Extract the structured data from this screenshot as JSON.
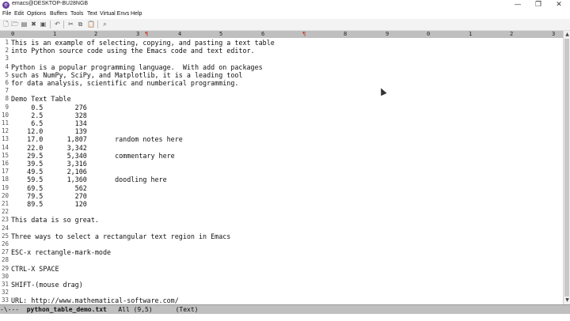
{
  "window": {
    "title": "emacs@DESKTOP-BU28NGB",
    "minimize_glyph": "—",
    "restore_glyph": "❐",
    "close_glyph": "✕"
  },
  "menu": [
    "File",
    "Edit",
    "Options",
    "Buffers",
    "Tools",
    "Text",
    "Virtual Envs",
    "Help"
  ],
  "toolbar": {
    "icons": [
      "new-file-icon",
      "open-folder-icon",
      "dired-icon",
      "close-buffer-icon",
      "save-icon",
      "undo-icon",
      "cut-icon",
      "copy-icon",
      "paste-icon",
      "search-icon"
    ]
  },
  "ruler": {
    "numbers": [
      "0",
      "1",
      "2",
      "3",
      "4",
      "5",
      "6",
      "7",
      "8",
      "9",
      "0",
      "1",
      "2",
      "3"
    ],
    "marker": "¶"
  },
  "buffer": {
    "lines": [
      "This is an example of selecting, copying, and pasting a text table",
      "into Python source code using the Emacs code and text editor.",
      "",
      "Python is a popular programming language.  With add on packages",
      "such as NumPy, SciPy, and Matplotlib, it is a leading tool",
      "for data analysis, scientific and numberical programming.",
      "",
      "Demo Text Table",
      "     0.5        276",
      "     2.5        328",
      "     6.5        134",
      "    12.0        139",
      "    17.0      1,807       random notes here",
      "    22.0      3,342",
      "    29.5      5,340       commentary here",
      "    39.5      3,316",
      "    49.5      2,106",
      "    59.5      1,360       doodling here",
      "    69.5        562",
      "    79.5        270",
      "    89.5        120",
      "",
      "This data is so great.",
      "",
      "Three ways to select a rectangular text region in Emacs",
      "",
      "ESC-x rectangle-mark-mode",
      "",
      "CTRL-X SPACE",
      "",
      "SHIFT-(mouse drag)",
      "",
      "URL: http://www.mathematical-software.com/"
    ]
  },
  "modeline": {
    "status": "-\\---  ",
    "buffer_name": "python_table_demo.txt",
    "position": "   All (9,5)      ",
    "mode": "(Text)"
  },
  "scrollbar": {
    "up_glyph": "▲",
    "down_glyph": "▼"
  }
}
